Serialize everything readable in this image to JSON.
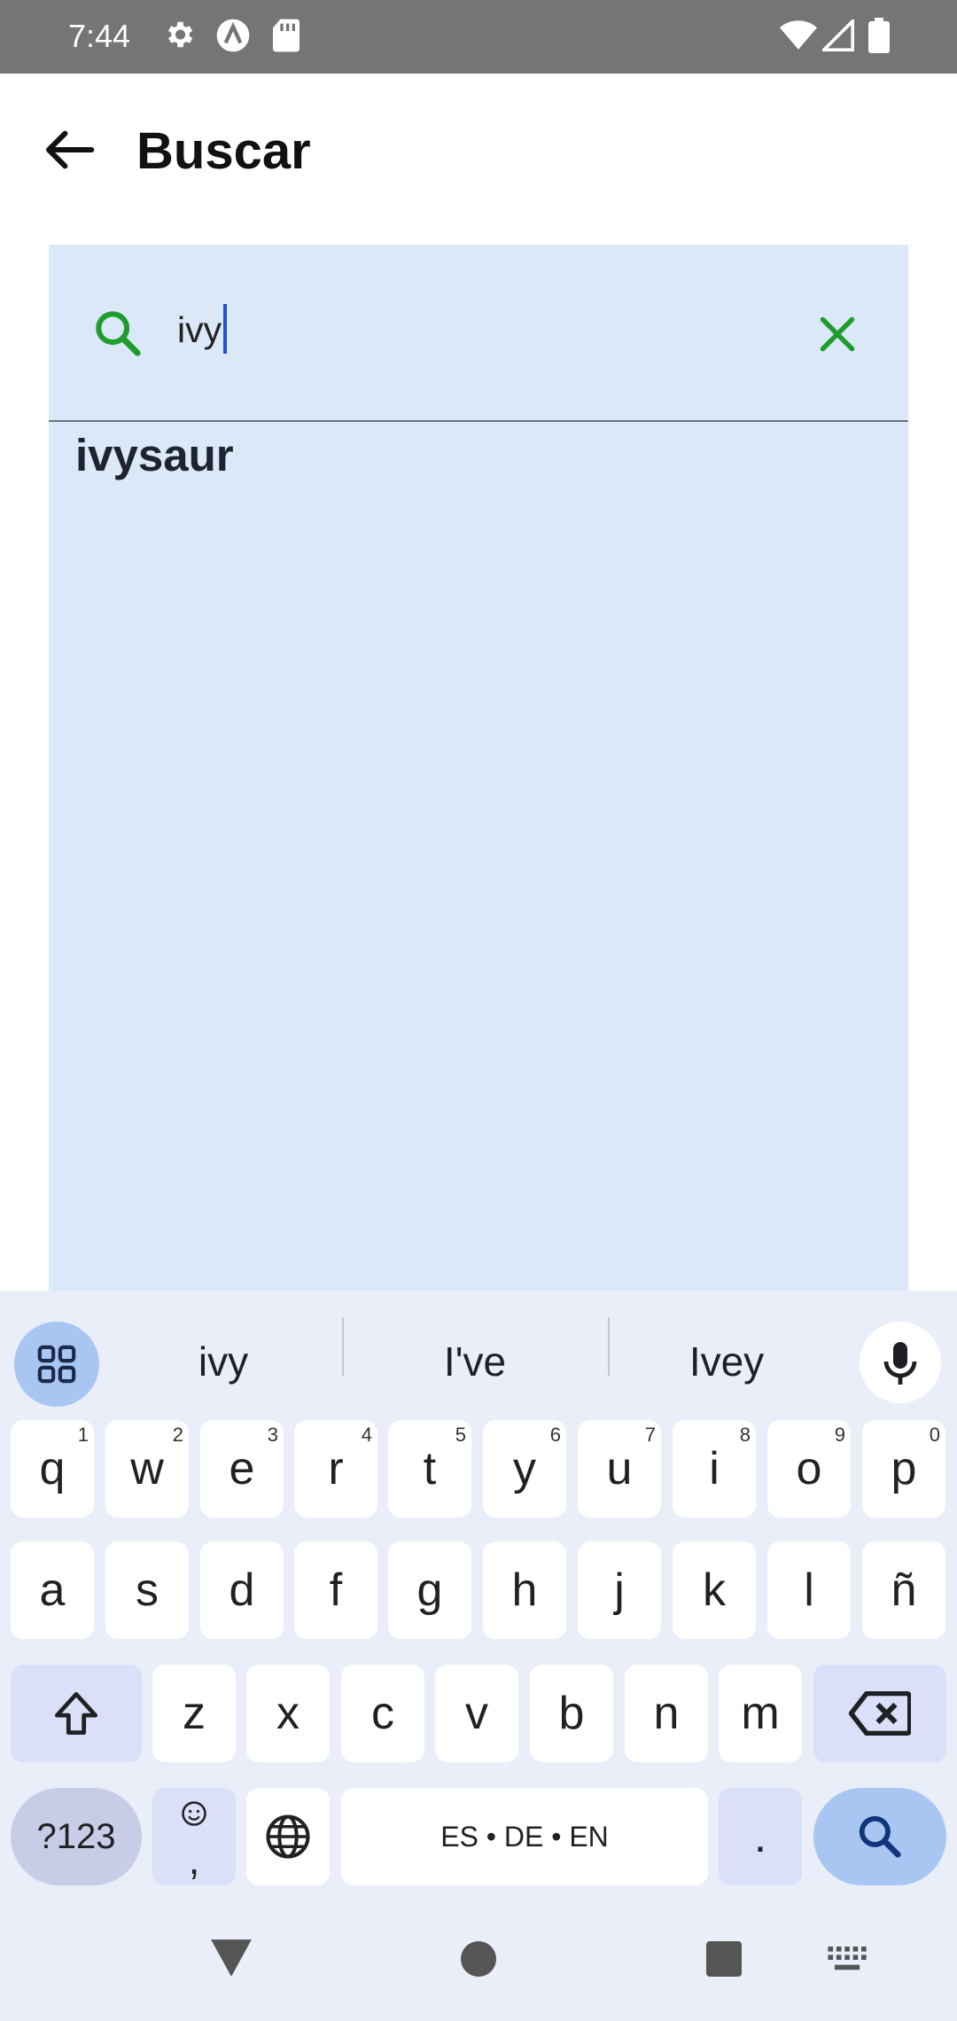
{
  "status_bar": {
    "time": "7:44",
    "left_icons": [
      "gear-icon",
      "a-badge-icon",
      "sd-card-icon"
    ],
    "right_icons": [
      "wifi-icon",
      "signal-icon",
      "battery-icon"
    ],
    "background": "#757575"
  },
  "app_bar": {
    "back_icon": "arrow-left-icon",
    "title": "Buscar"
  },
  "search": {
    "query": "ivy",
    "search_icon": "search-icon",
    "clear_icon": "close-icon",
    "accent_color": "#1f9d2b",
    "panel_color": "#dae8f7"
  },
  "results": [
    {
      "label": "ivysaur"
    }
  ],
  "keyboard": {
    "suggestions": [
      "ivy",
      "I've",
      "Ivey"
    ],
    "row1": [
      {
        "label": "q",
        "hint": "1"
      },
      {
        "label": "w",
        "hint": "2"
      },
      {
        "label": "e",
        "hint": "3"
      },
      {
        "label": "r",
        "hint": "4"
      },
      {
        "label": "t",
        "hint": "5"
      },
      {
        "label": "y",
        "hint": "6"
      },
      {
        "label": "u",
        "hint": "7"
      },
      {
        "label": "i",
        "hint": "8"
      },
      {
        "label": "o",
        "hint": "9"
      },
      {
        "label": "p",
        "hint": "0"
      }
    ],
    "row2": [
      "a",
      "s",
      "d",
      "f",
      "g",
      "h",
      "j",
      "k",
      "l",
      "ñ"
    ],
    "row3": [
      "z",
      "x",
      "c",
      "v",
      "b",
      "n",
      "m"
    ],
    "symbols_label": "?123",
    "emoji_key_label": ",",
    "space_label": "ES • DE • EN",
    "period_label": "."
  }
}
